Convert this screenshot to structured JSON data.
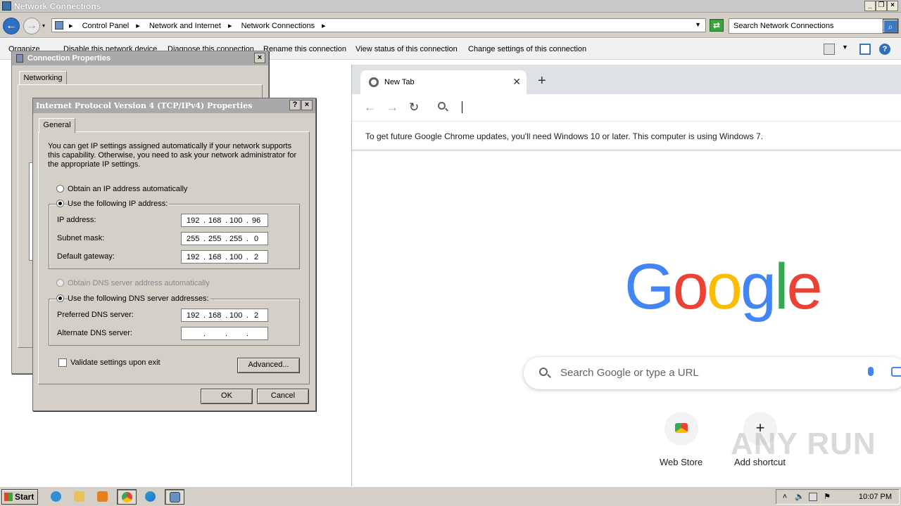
{
  "explorer": {
    "title": "Network Connections",
    "breadcrumb": [
      "Control Panel",
      "Network and Internet",
      "Network Connections"
    ],
    "search_placeholder": "Search Network Connections",
    "commands": [
      "Organize",
      "Disable this network device",
      "Diagnose this connection",
      "Rename this connection",
      "View status of this connection",
      "Change settings of this connection"
    ]
  },
  "conn_props": {
    "title": "Connection Properties",
    "tab": "Networking"
  },
  "ipv4": {
    "title": "Internet Protocol Version 4 (TCP/IPv4) Properties",
    "tab": "General",
    "intro": "You can get IP settings assigned automatically if your network supports this capability. Otherwise, you need to ask your network administrator for the appropriate IP settings.",
    "radio_auto_ip": "Obtain an IP address automatically",
    "radio_manual_ip": "Use the following IP address:",
    "ip_label": "IP address:",
    "mask_label": "Subnet mask:",
    "gateway_label": "Default gateway:",
    "ip": [
      "192",
      "168",
      "100",
      "96"
    ],
    "mask": [
      "255",
      "255",
      "255",
      "0"
    ],
    "gateway": [
      "192",
      "168",
      "100",
      "2"
    ],
    "radio_auto_dns": "Obtain DNS server address automatically",
    "radio_manual_dns": "Use the following DNS server addresses:",
    "pref_dns_label": "Preferred DNS server:",
    "alt_dns_label": "Alternate DNS server:",
    "pref_dns": [
      "192",
      "168",
      "100",
      "2"
    ],
    "validate_label": "Validate settings upon exit",
    "advanced_label": "Advanced...",
    "ok_label": "OK",
    "cancel_label": "Cancel"
  },
  "chrome": {
    "tab_title": "New Tab",
    "infobar": "To get future Google Chrome updates, you'll need Windows 10 or later. This computer is using Windows 7.",
    "logo": [
      "G",
      "o",
      "o",
      "g",
      "l",
      "e"
    ],
    "logo_colors": [
      "#4285f4",
      "#ea4335",
      "#fbbc05",
      "#4285f4",
      "#34a853",
      "#ea4335"
    ],
    "search_placeholder": "Search Google or type a URL",
    "shortcuts": [
      "Web Store",
      "Add shortcut"
    ],
    "watermark": "ANY RUN"
  },
  "taskbar": {
    "start_label": "Start",
    "clock": "10:07 PM"
  }
}
